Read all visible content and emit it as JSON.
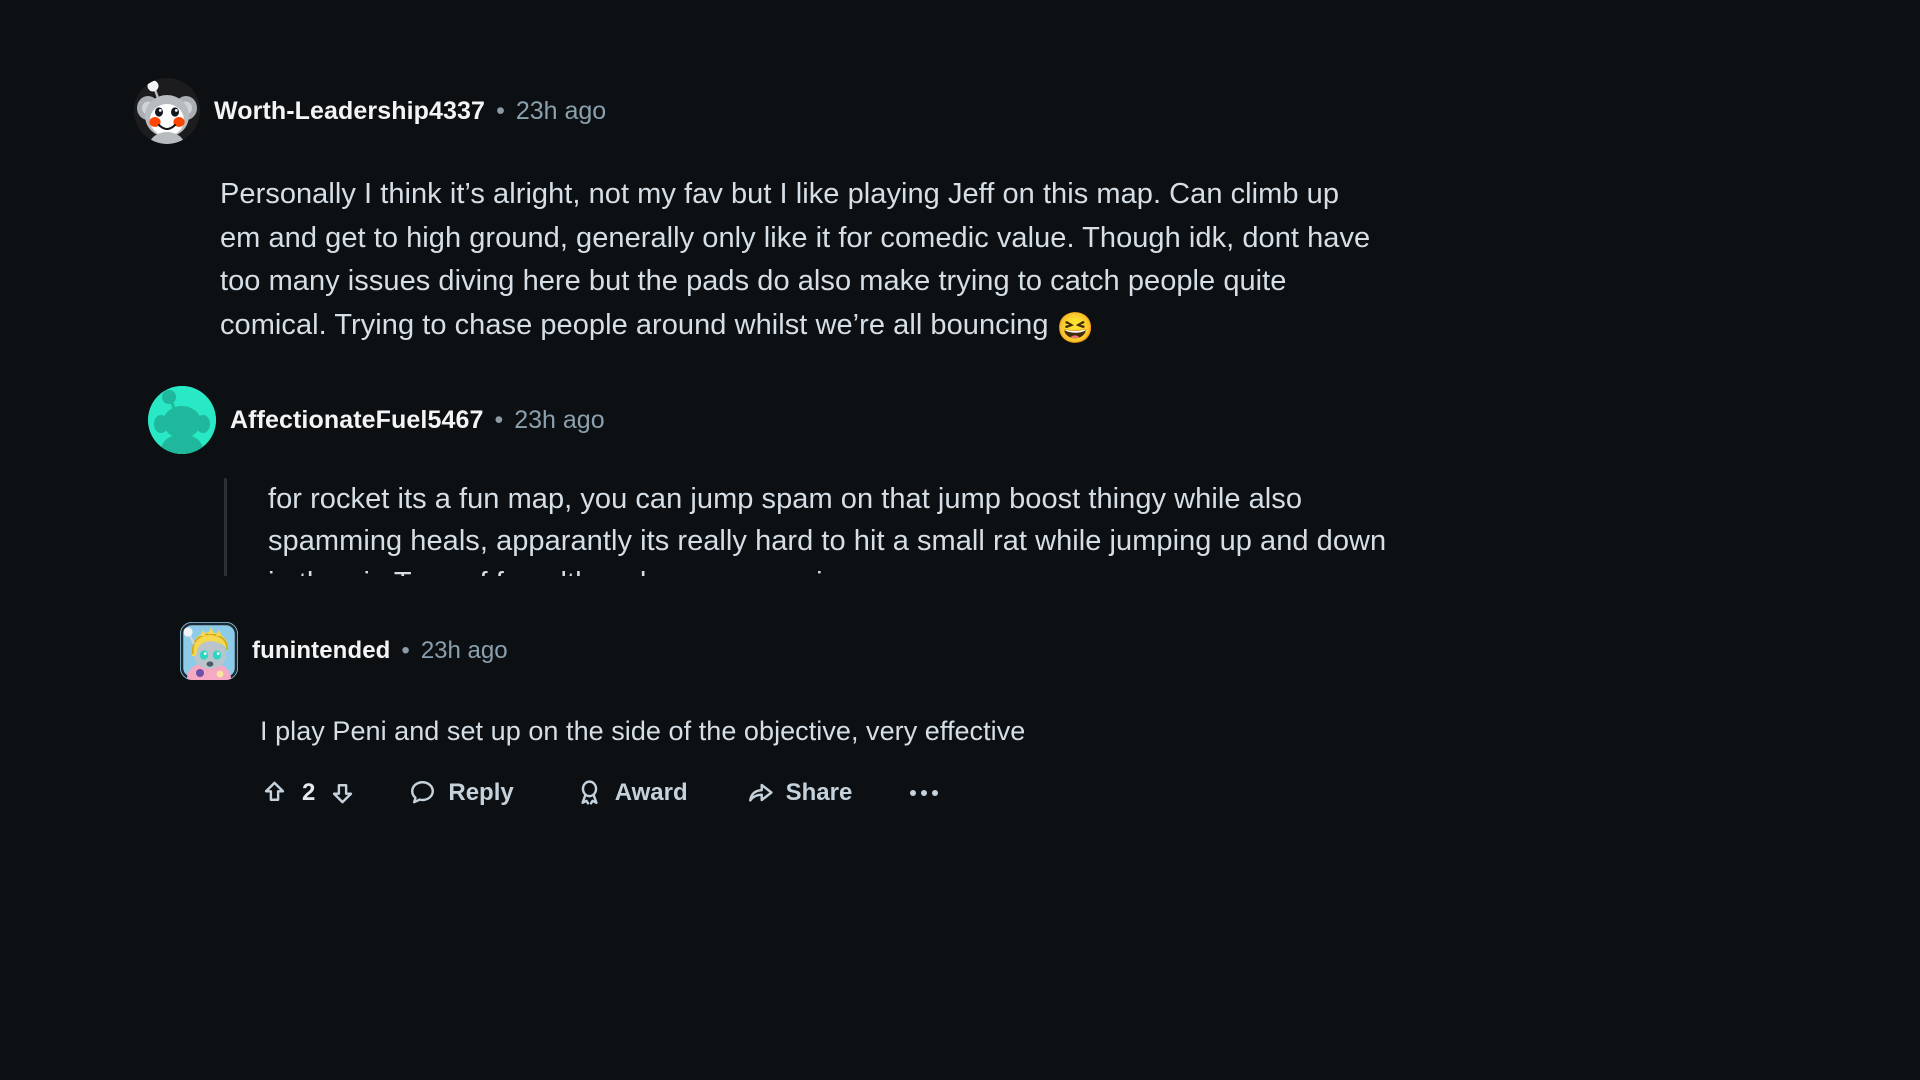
{
  "theme": {
    "background": "#0c1013",
    "body_text": "#d6dfe6",
    "author_text": "#f2f4f5",
    "meta_text": "#8ba0ae",
    "thread_line": "#2b3236",
    "action_text": "#c5d2dc",
    "avatar2_bg": "#29e8c5",
    "avatar3_bg": "#89c6e8"
  },
  "comments": [
    {
      "author": "Worth-Leadership4337",
      "separator": "•",
      "timestamp": "23h ago",
      "avatar_icon": "snoo-koala-avatar",
      "body": "Personally I think it’s alright, not my fav but I like playing Jeff on this map. Can climb up em and get to high ground, generally only like it for comedic value. Though idk, dont have too many issues diving here but the pads do also make trying to catch people quite comical. Trying to chase people around whilst we’re all bouncing ",
      "emoji": "😆"
    },
    {
      "author": "AffectionateFuel5467",
      "separator": "•",
      "timestamp": "23h ago",
      "avatar_icon": "snoo-teal-avatar",
      "body": "for rocket its a fun map, you can jump spam on that jump boost thingy while also spamming heals, apparantly its really hard to hit a small rat while jumping up and down in the air. Tons of fun although some enemies"
    },
    {
      "author": "funintended",
      "separator": "•",
      "timestamp": "23h ago",
      "avatar_icon": "snoo-collectible-avatar",
      "body": "I play Peni and set up on the side of the objective, very effective"
    }
  ],
  "actions": {
    "upvote_icon": "upvote-arrow-icon",
    "vote_count": "2",
    "downvote_icon": "downvote-arrow-icon",
    "reply_label": "Reply",
    "reply_icon": "comment-bubble-icon",
    "award_label": "Award",
    "award_icon": "award-ribbon-icon",
    "share_label": "Share",
    "share_icon": "share-arrow-icon",
    "more_icon": "more-options-icon"
  }
}
